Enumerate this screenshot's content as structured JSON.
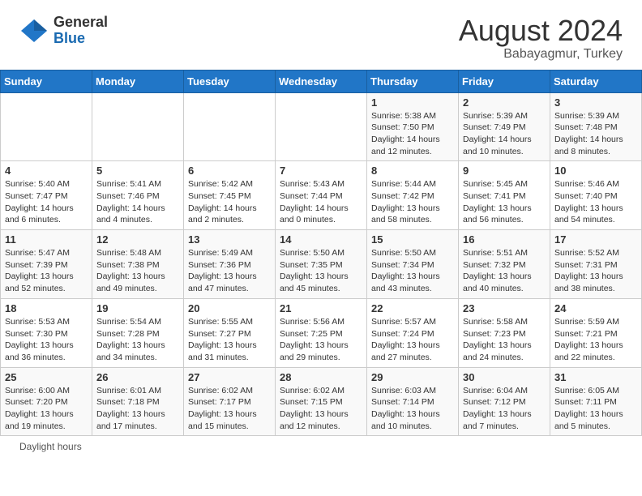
{
  "header": {
    "logo_general": "General",
    "logo_blue": "Blue",
    "month_title": "August 2024",
    "subtitle": "Babayagmur, Turkey"
  },
  "days_of_week": [
    "Sunday",
    "Monday",
    "Tuesday",
    "Wednesday",
    "Thursday",
    "Friday",
    "Saturday"
  ],
  "weeks": [
    [
      {
        "num": "",
        "info": ""
      },
      {
        "num": "",
        "info": ""
      },
      {
        "num": "",
        "info": ""
      },
      {
        "num": "",
        "info": ""
      },
      {
        "num": "1",
        "info": "Sunrise: 5:38 AM\nSunset: 7:50 PM\nDaylight: 14 hours and 12 minutes."
      },
      {
        "num": "2",
        "info": "Sunrise: 5:39 AM\nSunset: 7:49 PM\nDaylight: 14 hours and 10 minutes."
      },
      {
        "num": "3",
        "info": "Sunrise: 5:39 AM\nSunset: 7:48 PM\nDaylight: 14 hours and 8 minutes."
      }
    ],
    [
      {
        "num": "4",
        "info": "Sunrise: 5:40 AM\nSunset: 7:47 PM\nDaylight: 14 hours and 6 minutes."
      },
      {
        "num": "5",
        "info": "Sunrise: 5:41 AM\nSunset: 7:46 PM\nDaylight: 14 hours and 4 minutes."
      },
      {
        "num": "6",
        "info": "Sunrise: 5:42 AM\nSunset: 7:45 PM\nDaylight: 14 hours and 2 minutes."
      },
      {
        "num": "7",
        "info": "Sunrise: 5:43 AM\nSunset: 7:44 PM\nDaylight: 14 hours and 0 minutes."
      },
      {
        "num": "8",
        "info": "Sunrise: 5:44 AM\nSunset: 7:42 PM\nDaylight: 13 hours and 58 minutes."
      },
      {
        "num": "9",
        "info": "Sunrise: 5:45 AM\nSunset: 7:41 PM\nDaylight: 13 hours and 56 minutes."
      },
      {
        "num": "10",
        "info": "Sunrise: 5:46 AM\nSunset: 7:40 PM\nDaylight: 13 hours and 54 minutes."
      }
    ],
    [
      {
        "num": "11",
        "info": "Sunrise: 5:47 AM\nSunset: 7:39 PM\nDaylight: 13 hours and 52 minutes."
      },
      {
        "num": "12",
        "info": "Sunrise: 5:48 AM\nSunset: 7:38 PM\nDaylight: 13 hours and 49 minutes."
      },
      {
        "num": "13",
        "info": "Sunrise: 5:49 AM\nSunset: 7:36 PM\nDaylight: 13 hours and 47 minutes."
      },
      {
        "num": "14",
        "info": "Sunrise: 5:50 AM\nSunset: 7:35 PM\nDaylight: 13 hours and 45 minutes."
      },
      {
        "num": "15",
        "info": "Sunrise: 5:50 AM\nSunset: 7:34 PM\nDaylight: 13 hours and 43 minutes."
      },
      {
        "num": "16",
        "info": "Sunrise: 5:51 AM\nSunset: 7:32 PM\nDaylight: 13 hours and 40 minutes."
      },
      {
        "num": "17",
        "info": "Sunrise: 5:52 AM\nSunset: 7:31 PM\nDaylight: 13 hours and 38 minutes."
      }
    ],
    [
      {
        "num": "18",
        "info": "Sunrise: 5:53 AM\nSunset: 7:30 PM\nDaylight: 13 hours and 36 minutes."
      },
      {
        "num": "19",
        "info": "Sunrise: 5:54 AM\nSunset: 7:28 PM\nDaylight: 13 hours and 34 minutes."
      },
      {
        "num": "20",
        "info": "Sunrise: 5:55 AM\nSunset: 7:27 PM\nDaylight: 13 hours and 31 minutes."
      },
      {
        "num": "21",
        "info": "Sunrise: 5:56 AM\nSunset: 7:25 PM\nDaylight: 13 hours and 29 minutes."
      },
      {
        "num": "22",
        "info": "Sunrise: 5:57 AM\nSunset: 7:24 PM\nDaylight: 13 hours and 27 minutes."
      },
      {
        "num": "23",
        "info": "Sunrise: 5:58 AM\nSunset: 7:23 PM\nDaylight: 13 hours and 24 minutes."
      },
      {
        "num": "24",
        "info": "Sunrise: 5:59 AM\nSunset: 7:21 PM\nDaylight: 13 hours and 22 minutes."
      }
    ],
    [
      {
        "num": "25",
        "info": "Sunrise: 6:00 AM\nSunset: 7:20 PM\nDaylight: 13 hours and 19 minutes."
      },
      {
        "num": "26",
        "info": "Sunrise: 6:01 AM\nSunset: 7:18 PM\nDaylight: 13 hours and 17 minutes."
      },
      {
        "num": "27",
        "info": "Sunrise: 6:02 AM\nSunset: 7:17 PM\nDaylight: 13 hours and 15 minutes."
      },
      {
        "num": "28",
        "info": "Sunrise: 6:02 AM\nSunset: 7:15 PM\nDaylight: 13 hours and 12 minutes."
      },
      {
        "num": "29",
        "info": "Sunrise: 6:03 AM\nSunset: 7:14 PM\nDaylight: 13 hours and 10 minutes."
      },
      {
        "num": "30",
        "info": "Sunrise: 6:04 AM\nSunset: 7:12 PM\nDaylight: 13 hours and 7 minutes."
      },
      {
        "num": "31",
        "info": "Sunrise: 6:05 AM\nSunset: 7:11 PM\nDaylight: 13 hours and 5 minutes."
      }
    ]
  ],
  "footer": {
    "daylight_label": "Daylight hours"
  }
}
